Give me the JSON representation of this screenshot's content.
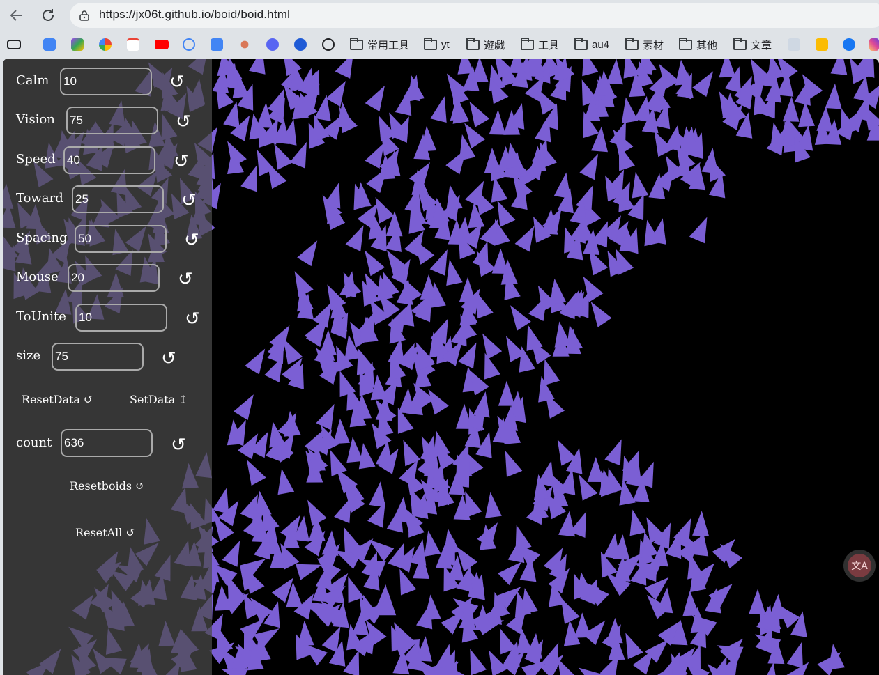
{
  "browser": {
    "url": "https://jx06t.github.io/boid/boid.html",
    "back_icon": "arrow-left-icon",
    "reload_icon": "reload-icon"
  },
  "bookmarks": {
    "folders": [
      "常用工具",
      "yt",
      "遊戲",
      "工具",
      "au4",
      "素材",
      "其他",
      "文章"
    ]
  },
  "controls": {
    "calm": {
      "label": "Calm",
      "value": "10"
    },
    "vision": {
      "label": "Vision",
      "value": "75"
    },
    "speed": {
      "label": "Speed",
      "value": "40"
    },
    "toward": {
      "label": "Toward",
      "value": "25"
    },
    "spacing": {
      "label": "Spacing",
      "value": "50"
    },
    "mouse": {
      "label": "Mouse",
      "value": "20"
    },
    "tounite": {
      "label": "ToUnite",
      "value": "10"
    },
    "size": {
      "label": "size",
      "value": "75"
    },
    "reset_glyph": "↺",
    "reset_data": "ResetData ↺",
    "set_data": "SetData ↥",
    "count": {
      "label": "count",
      "value": "636"
    },
    "reset_boids": "Resetboids ↺",
    "reset_all": "ResetAll ↺"
  },
  "colors": {
    "boid": "#7b5fd4",
    "background": "#000000",
    "panel": "#4b4b4b"
  }
}
